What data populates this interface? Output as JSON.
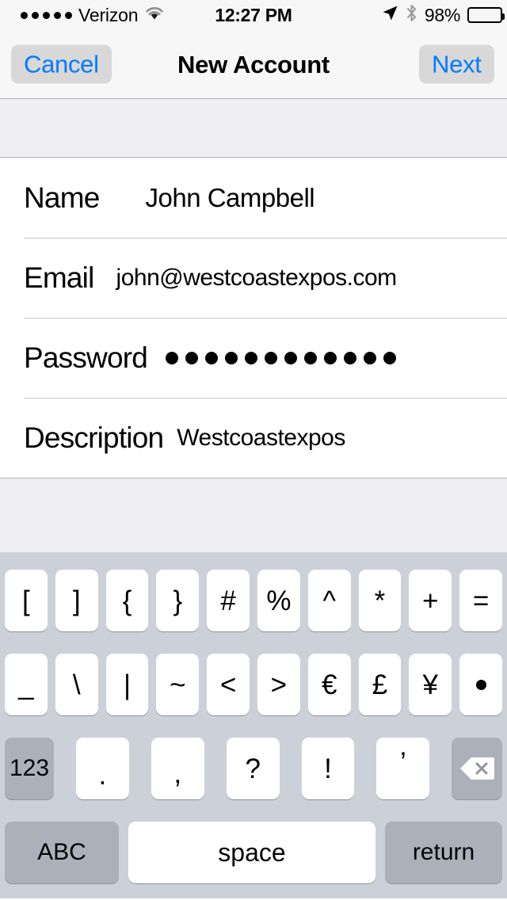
{
  "status_bar": {
    "signal_dots": 5,
    "carrier": "Verizon",
    "wifi_icon": "wifi-icon",
    "time": "12:27 PM",
    "location_icon": "location-arrow-icon",
    "bluetooth_icon": "bluetooth-icon",
    "battery_percent": "98%",
    "battery_level": 96
  },
  "nav_bar": {
    "cancel_label": "Cancel",
    "title": "New Account",
    "next_label": "Next",
    "tint_color": "#007aff",
    "highlight_color": "#d8d8d8"
  },
  "form": {
    "rows": [
      {
        "label": "Name",
        "value": "John Campbell",
        "type": "text"
      },
      {
        "label": "Email",
        "value": "john@westcoastexpos.com",
        "type": "email"
      },
      {
        "label": "Password",
        "value": "............",
        "type": "password",
        "dot_count": 12
      },
      {
        "label": "Description",
        "value": "Westcoastexpos",
        "type": "text"
      }
    ]
  },
  "keyboard": {
    "layout": "symbols",
    "background_color": "#ccd0d9",
    "key_color": "#ffffff",
    "modifier_key_color": "#abb0bb",
    "row1": [
      "[",
      "]",
      "{",
      "}",
      "#",
      "%",
      "^",
      "*",
      "+",
      "="
    ],
    "row2": [
      "_",
      "\\",
      "|",
      "~",
      "<",
      ">",
      "€",
      "£",
      "¥",
      "•"
    ],
    "row3": {
      "numeric_label": "123",
      "punct": [
        ".",
        ",",
        "?",
        "!",
        "’"
      ],
      "backspace_icon": "backspace-delete-icon"
    },
    "row4": {
      "abc_label": "ABC",
      "space_label": "space",
      "return_label": "return"
    }
  }
}
